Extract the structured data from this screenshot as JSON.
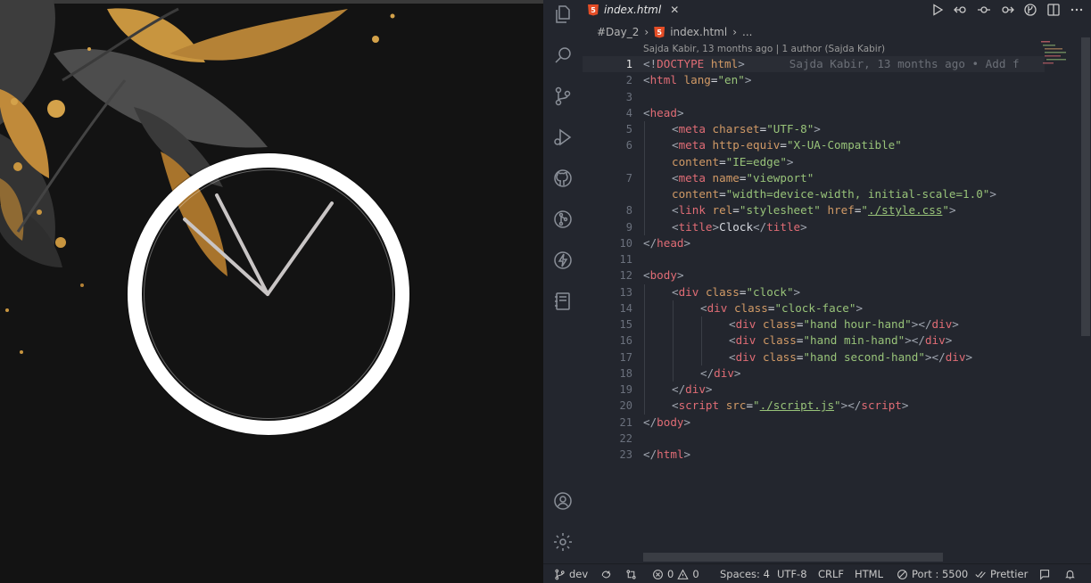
{
  "tab": {
    "label": "index.html",
    "close": "✕",
    "file_badge": "5"
  },
  "breadcrumb": {
    "folder": "#Day_2",
    "file": "index.html",
    "sep": "›",
    "more": "..."
  },
  "blame_header": "Sajda Kabir, 13 months ago | 1 author (Sajda Kabir)",
  "current_line": 1,
  "blame_inline": "Sajda Kabir, 13 months ago • Add f",
  "code_lines": [
    {
      "n": "1",
      "indent": 0,
      "tokens": [
        [
          "br",
          "<!"
        ],
        [
          "tag",
          "DOCTYPE"
        ],
        [
          "txt",
          " "
        ],
        [
          "attr",
          "html"
        ],
        [
          "br",
          ">"
        ]
      ]
    },
    {
      "n": "2",
      "indent": 0,
      "tokens": [
        [
          "br",
          "<"
        ],
        [
          "tag",
          "html"
        ],
        [
          "txt",
          " "
        ],
        [
          "attr",
          "lang"
        ],
        [
          "txt",
          "="
        ],
        [
          "str",
          "\"en\""
        ],
        [
          "br",
          ">"
        ]
      ]
    },
    {
      "n": "3",
      "indent": 0,
      "tokens": []
    },
    {
      "n": "4",
      "indent": 0,
      "tokens": [
        [
          "br",
          "<"
        ],
        [
          "tag",
          "head"
        ],
        [
          "br",
          ">"
        ]
      ]
    },
    {
      "n": "5",
      "indent": 1,
      "tokens": [
        [
          "br",
          "<"
        ],
        [
          "tag",
          "meta"
        ],
        [
          "txt",
          " "
        ],
        [
          "attr",
          "charset"
        ],
        [
          "txt",
          "="
        ],
        [
          "str",
          "\"UTF-8\""
        ],
        [
          "br",
          ">"
        ]
      ]
    },
    {
      "n": "6",
      "indent": 1,
      "tokens": [
        [
          "br",
          "<"
        ],
        [
          "tag",
          "meta"
        ],
        [
          "txt",
          " "
        ],
        [
          "attr",
          "http-equiv"
        ],
        [
          "txt",
          "="
        ],
        [
          "str",
          "\"X-UA-Compatible\""
        ]
      ]
    },
    {
      "n": "",
      "indent": 1,
      "tokens": [
        [
          "attr",
          "content"
        ],
        [
          "txt",
          "="
        ],
        [
          "str",
          "\"IE=edge\""
        ],
        [
          "br",
          ">"
        ]
      ]
    },
    {
      "n": "7",
      "indent": 1,
      "tokens": [
        [
          "br",
          "<"
        ],
        [
          "tag",
          "meta"
        ],
        [
          "txt",
          " "
        ],
        [
          "attr",
          "name"
        ],
        [
          "txt",
          "="
        ],
        [
          "str",
          "\"viewport\""
        ]
      ]
    },
    {
      "n": "",
      "indent": 1,
      "tokens": [
        [
          "attr",
          "content"
        ],
        [
          "txt",
          "="
        ],
        [
          "str",
          "\"width=device-width, initial-scale=1.0\""
        ],
        [
          "br",
          ">"
        ]
      ]
    },
    {
      "n": "8",
      "indent": 1,
      "tokens": [
        [
          "br",
          "<"
        ],
        [
          "tag",
          "link"
        ],
        [
          "txt",
          " "
        ],
        [
          "attr",
          "rel"
        ],
        [
          "txt",
          "="
        ],
        [
          "str",
          "\"stylesheet\""
        ],
        [
          "txt",
          " "
        ],
        [
          "attr",
          "href"
        ],
        [
          "txt",
          "="
        ],
        [
          "str",
          "\""
        ],
        [
          "link",
          "./style.css"
        ],
        [
          "str",
          "\""
        ],
        [
          "br",
          ">"
        ]
      ]
    },
    {
      "n": "9",
      "indent": 1,
      "tokens": [
        [
          "br",
          "<"
        ],
        [
          "tag",
          "title"
        ],
        [
          "br",
          ">"
        ],
        [
          "txt",
          "Clock"
        ],
        [
          "br",
          "</"
        ],
        [
          "tag",
          "title"
        ],
        [
          "br",
          ">"
        ]
      ]
    },
    {
      "n": "10",
      "indent": 0,
      "tokens": [
        [
          "br",
          "</"
        ],
        [
          "tag",
          "head"
        ],
        [
          "br",
          ">"
        ]
      ]
    },
    {
      "n": "11",
      "indent": 0,
      "tokens": []
    },
    {
      "n": "12",
      "indent": 0,
      "tokens": [
        [
          "br",
          "<"
        ],
        [
          "tag",
          "body"
        ],
        [
          "br",
          ">"
        ]
      ]
    },
    {
      "n": "13",
      "indent": 1,
      "tokens": [
        [
          "br",
          "<"
        ],
        [
          "tag",
          "div"
        ],
        [
          "txt",
          " "
        ],
        [
          "attr",
          "class"
        ],
        [
          "txt",
          "="
        ],
        [
          "str",
          "\"clock\""
        ],
        [
          "br",
          ">"
        ]
      ]
    },
    {
      "n": "14",
      "indent": 2,
      "tokens": [
        [
          "br",
          "<"
        ],
        [
          "tag",
          "div"
        ],
        [
          "txt",
          " "
        ],
        [
          "attr",
          "class"
        ],
        [
          "txt",
          "="
        ],
        [
          "str",
          "\"clock-face\""
        ],
        [
          "br",
          ">"
        ]
      ]
    },
    {
      "n": "15",
      "indent": 3,
      "tokens": [
        [
          "br",
          "<"
        ],
        [
          "tag",
          "div"
        ],
        [
          "txt",
          " "
        ],
        [
          "attr",
          "class"
        ],
        [
          "txt",
          "="
        ],
        [
          "str",
          "\"hand hour-hand\""
        ],
        [
          "br",
          "></"
        ],
        [
          "tag",
          "div"
        ],
        [
          "br",
          ">"
        ]
      ]
    },
    {
      "n": "16",
      "indent": 3,
      "tokens": [
        [
          "br",
          "<"
        ],
        [
          "tag",
          "div"
        ],
        [
          "txt",
          " "
        ],
        [
          "attr",
          "class"
        ],
        [
          "txt",
          "="
        ],
        [
          "str",
          "\"hand min-hand\""
        ],
        [
          "br",
          "></"
        ],
        [
          "tag",
          "div"
        ],
        [
          "br",
          ">"
        ]
      ]
    },
    {
      "n": "17",
      "indent": 3,
      "tokens": [
        [
          "br",
          "<"
        ],
        [
          "tag",
          "div"
        ],
        [
          "txt",
          " "
        ],
        [
          "attr",
          "class"
        ],
        [
          "txt",
          "="
        ],
        [
          "str",
          "\"hand second-hand\""
        ],
        [
          "br",
          "></"
        ],
        [
          "tag",
          "div"
        ],
        [
          "br",
          ">"
        ]
      ]
    },
    {
      "n": "18",
      "indent": 2,
      "tokens": [
        [
          "br",
          "</"
        ],
        [
          "tag",
          "div"
        ],
        [
          "br",
          ">"
        ]
      ]
    },
    {
      "n": "19",
      "indent": 1,
      "tokens": [
        [
          "br",
          "</"
        ],
        [
          "tag",
          "div"
        ],
        [
          "br",
          ">"
        ]
      ]
    },
    {
      "n": "20",
      "indent": 1,
      "tokens": [
        [
          "br",
          "<"
        ],
        [
          "tag",
          "script"
        ],
        [
          "txt",
          " "
        ],
        [
          "attr",
          "src"
        ],
        [
          "txt",
          "="
        ],
        [
          "str",
          "\""
        ],
        [
          "link",
          "./script.js"
        ],
        [
          "str",
          "\""
        ],
        [
          "br",
          "></"
        ],
        [
          "tag",
          "script"
        ],
        [
          "br",
          ">"
        ]
      ]
    },
    {
      "n": "21",
      "indent": 0,
      "tokens": [
        [
          "br",
          "</"
        ],
        [
          "tag",
          "body"
        ],
        [
          "br",
          ">"
        ]
      ]
    },
    {
      "n": "22",
      "indent": 0,
      "tokens": []
    },
    {
      "n": "23",
      "indent": 0,
      "tokens": [
        [
          "br",
          "</"
        ],
        [
          "tag",
          "html"
        ],
        [
          "br",
          ">"
        ]
      ]
    }
  ],
  "status": {
    "branch": "dev",
    "errors": "0",
    "warnings": "0",
    "spaces": "Spaces: 4",
    "encoding": "UTF-8",
    "eol": "CRLF",
    "language": "HTML",
    "port": "Port : 5500",
    "prettier": "Prettier"
  },
  "colors": {
    "editor_bg": "#23262e",
    "tag": "#e06c75",
    "attr": "#d19a66",
    "string": "#98c379",
    "clock_ring": "#ffffff",
    "clock_hands": "#c9c5c5",
    "leaf_gold": "#c8953f",
    "leaf_grey": "#4a4a4a"
  },
  "icons": {
    "activity": [
      "files-icon",
      "search-icon",
      "source-control-icon",
      "run-debug-icon",
      "github-icon",
      "git-graph-icon",
      "lightning-icon",
      "notebook-icon",
      "account-icon",
      "settings-gear-icon"
    ],
    "editor_actions": [
      "run-icon",
      "open-changes-icon",
      "previous-change-icon",
      "next-change-icon",
      "live-share-icon",
      "split-editor-icon",
      "more-actions-icon"
    ]
  }
}
